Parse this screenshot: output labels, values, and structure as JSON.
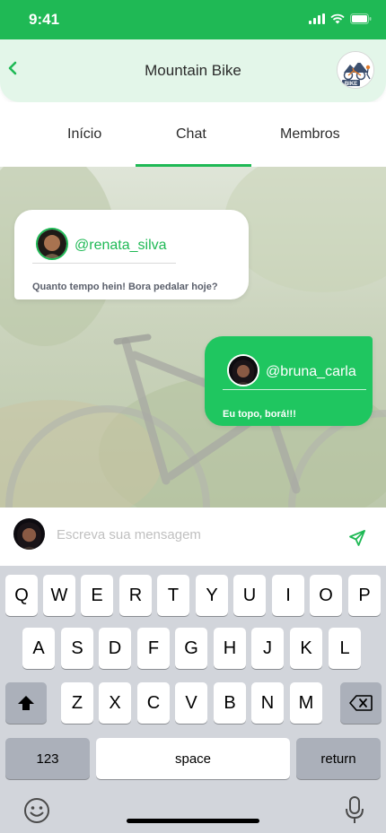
{
  "status": {
    "time": "9:41"
  },
  "header": {
    "title": "Mountain Bike",
    "group_avatar_text": "BIKE"
  },
  "tabs": [
    {
      "label": "Início"
    },
    {
      "label": "Chat"
    },
    {
      "label": "Membros"
    }
  ],
  "messages": [
    {
      "user": "@renata_silva",
      "text": "Quanto tempo hein! Bora pedalar hoje?"
    },
    {
      "user": "@bruna_carla",
      "text": "Eu topo, borá!!!"
    }
  ],
  "composer": {
    "placeholder": "Escreva sua mensagem"
  },
  "keyboard": {
    "row1": [
      "Q",
      "W",
      "E",
      "R",
      "T",
      "Y",
      "U",
      "I",
      "O",
      "P"
    ],
    "row2": [
      "A",
      "S",
      "D",
      "F",
      "G",
      "H",
      "J",
      "K",
      "L"
    ],
    "row3": [
      "Z",
      "X",
      "C",
      "V",
      "B",
      "N",
      "M"
    ],
    "numbers_label": "123",
    "space_label": "space",
    "return_label": "return"
  },
  "colors": {
    "brand_green": "#1fb955",
    "bubble_green": "#1fc660",
    "header_bg": "#e3f6e9"
  }
}
